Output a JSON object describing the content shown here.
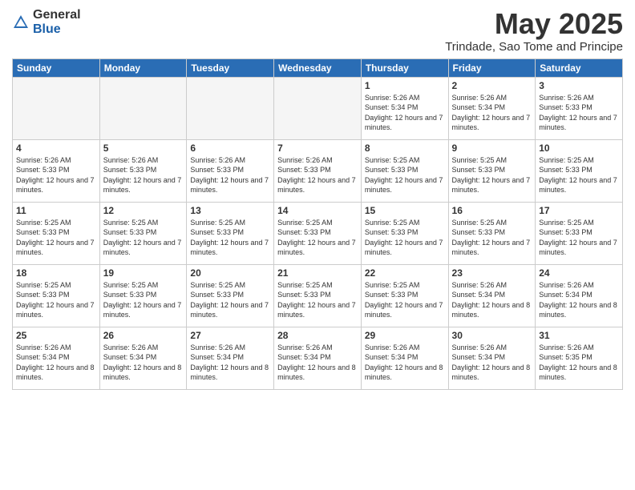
{
  "logo": {
    "general": "General",
    "blue": "Blue"
  },
  "title": "May 2025",
  "subtitle": "Trindade, Sao Tome and Principe",
  "days_header": [
    "Sunday",
    "Monday",
    "Tuesday",
    "Wednesday",
    "Thursday",
    "Friday",
    "Saturday"
  ],
  "weeks": [
    [
      {
        "day": "",
        "empty": true
      },
      {
        "day": "",
        "empty": true
      },
      {
        "day": "",
        "empty": true
      },
      {
        "day": "",
        "empty": true
      },
      {
        "day": "1",
        "sunrise": "5:26 AM",
        "sunset": "5:34 PM",
        "daylight": "12 hours and 7 minutes."
      },
      {
        "day": "2",
        "sunrise": "5:26 AM",
        "sunset": "5:34 PM",
        "daylight": "12 hours and 7 minutes."
      },
      {
        "day": "3",
        "sunrise": "5:26 AM",
        "sunset": "5:33 PM",
        "daylight": "12 hours and 7 minutes."
      }
    ],
    [
      {
        "day": "4",
        "sunrise": "5:26 AM",
        "sunset": "5:33 PM",
        "daylight": "12 hours and 7 minutes."
      },
      {
        "day": "5",
        "sunrise": "5:26 AM",
        "sunset": "5:33 PM",
        "daylight": "12 hours and 7 minutes."
      },
      {
        "day": "6",
        "sunrise": "5:26 AM",
        "sunset": "5:33 PM",
        "daylight": "12 hours and 7 minutes."
      },
      {
        "day": "7",
        "sunrise": "5:26 AM",
        "sunset": "5:33 PM",
        "daylight": "12 hours and 7 minutes."
      },
      {
        "day": "8",
        "sunrise": "5:25 AM",
        "sunset": "5:33 PM",
        "daylight": "12 hours and 7 minutes."
      },
      {
        "day": "9",
        "sunrise": "5:25 AM",
        "sunset": "5:33 PM",
        "daylight": "12 hours and 7 minutes."
      },
      {
        "day": "10",
        "sunrise": "5:25 AM",
        "sunset": "5:33 PM",
        "daylight": "12 hours and 7 minutes."
      }
    ],
    [
      {
        "day": "11",
        "sunrise": "5:25 AM",
        "sunset": "5:33 PM",
        "daylight": "12 hours and 7 minutes."
      },
      {
        "day": "12",
        "sunrise": "5:25 AM",
        "sunset": "5:33 PM",
        "daylight": "12 hours and 7 minutes."
      },
      {
        "day": "13",
        "sunrise": "5:25 AM",
        "sunset": "5:33 PM",
        "daylight": "12 hours and 7 minutes."
      },
      {
        "day": "14",
        "sunrise": "5:25 AM",
        "sunset": "5:33 PM",
        "daylight": "12 hours and 7 minutes."
      },
      {
        "day": "15",
        "sunrise": "5:25 AM",
        "sunset": "5:33 PM",
        "daylight": "12 hours and 7 minutes."
      },
      {
        "day": "16",
        "sunrise": "5:25 AM",
        "sunset": "5:33 PM",
        "daylight": "12 hours and 7 minutes."
      },
      {
        "day": "17",
        "sunrise": "5:25 AM",
        "sunset": "5:33 PM",
        "daylight": "12 hours and 7 minutes."
      }
    ],
    [
      {
        "day": "18",
        "sunrise": "5:25 AM",
        "sunset": "5:33 PM",
        "daylight": "12 hours and 7 minutes."
      },
      {
        "day": "19",
        "sunrise": "5:25 AM",
        "sunset": "5:33 PM",
        "daylight": "12 hours and 7 minutes."
      },
      {
        "day": "20",
        "sunrise": "5:25 AM",
        "sunset": "5:33 PM",
        "daylight": "12 hours and 7 minutes."
      },
      {
        "day": "21",
        "sunrise": "5:25 AM",
        "sunset": "5:33 PM",
        "daylight": "12 hours and 7 minutes."
      },
      {
        "day": "22",
        "sunrise": "5:25 AM",
        "sunset": "5:33 PM",
        "daylight": "12 hours and 7 minutes."
      },
      {
        "day": "23",
        "sunrise": "5:26 AM",
        "sunset": "5:34 PM",
        "daylight": "12 hours and 8 minutes."
      },
      {
        "day": "24",
        "sunrise": "5:26 AM",
        "sunset": "5:34 PM",
        "daylight": "12 hours and 8 minutes."
      }
    ],
    [
      {
        "day": "25",
        "sunrise": "5:26 AM",
        "sunset": "5:34 PM",
        "daylight": "12 hours and 8 minutes."
      },
      {
        "day": "26",
        "sunrise": "5:26 AM",
        "sunset": "5:34 PM",
        "daylight": "12 hours and 8 minutes."
      },
      {
        "day": "27",
        "sunrise": "5:26 AM",
        "sunset": "5:34 PM",
        "daylight": "12 hours and 8 minutes."
      },
      {
        "day": "28",
        "sunrise": "5:26 AM",
        "sunset": "5:34 PM",
        "daylight": "12 hours and 8 minutes."
      },
      {
        "day": "29",
        "sunrise": "5:26 AM",
        "sunset": "5:34 PM",
        "daylight": "12 hours and 8 minutes."
      },
      {
        "day": "30",
        "sunrise": "5:26 AM",
        "sunset": "5:34 PM",
        "daylight": "12 hours and 8 minutes."
      },
      {
        "day": "31",
        "sunrise": "5:26 AM",
        "sunset": "5:35 PM",
        "daylight": "12 hours and 8 minutes."
      }
    ]
  ]
}
